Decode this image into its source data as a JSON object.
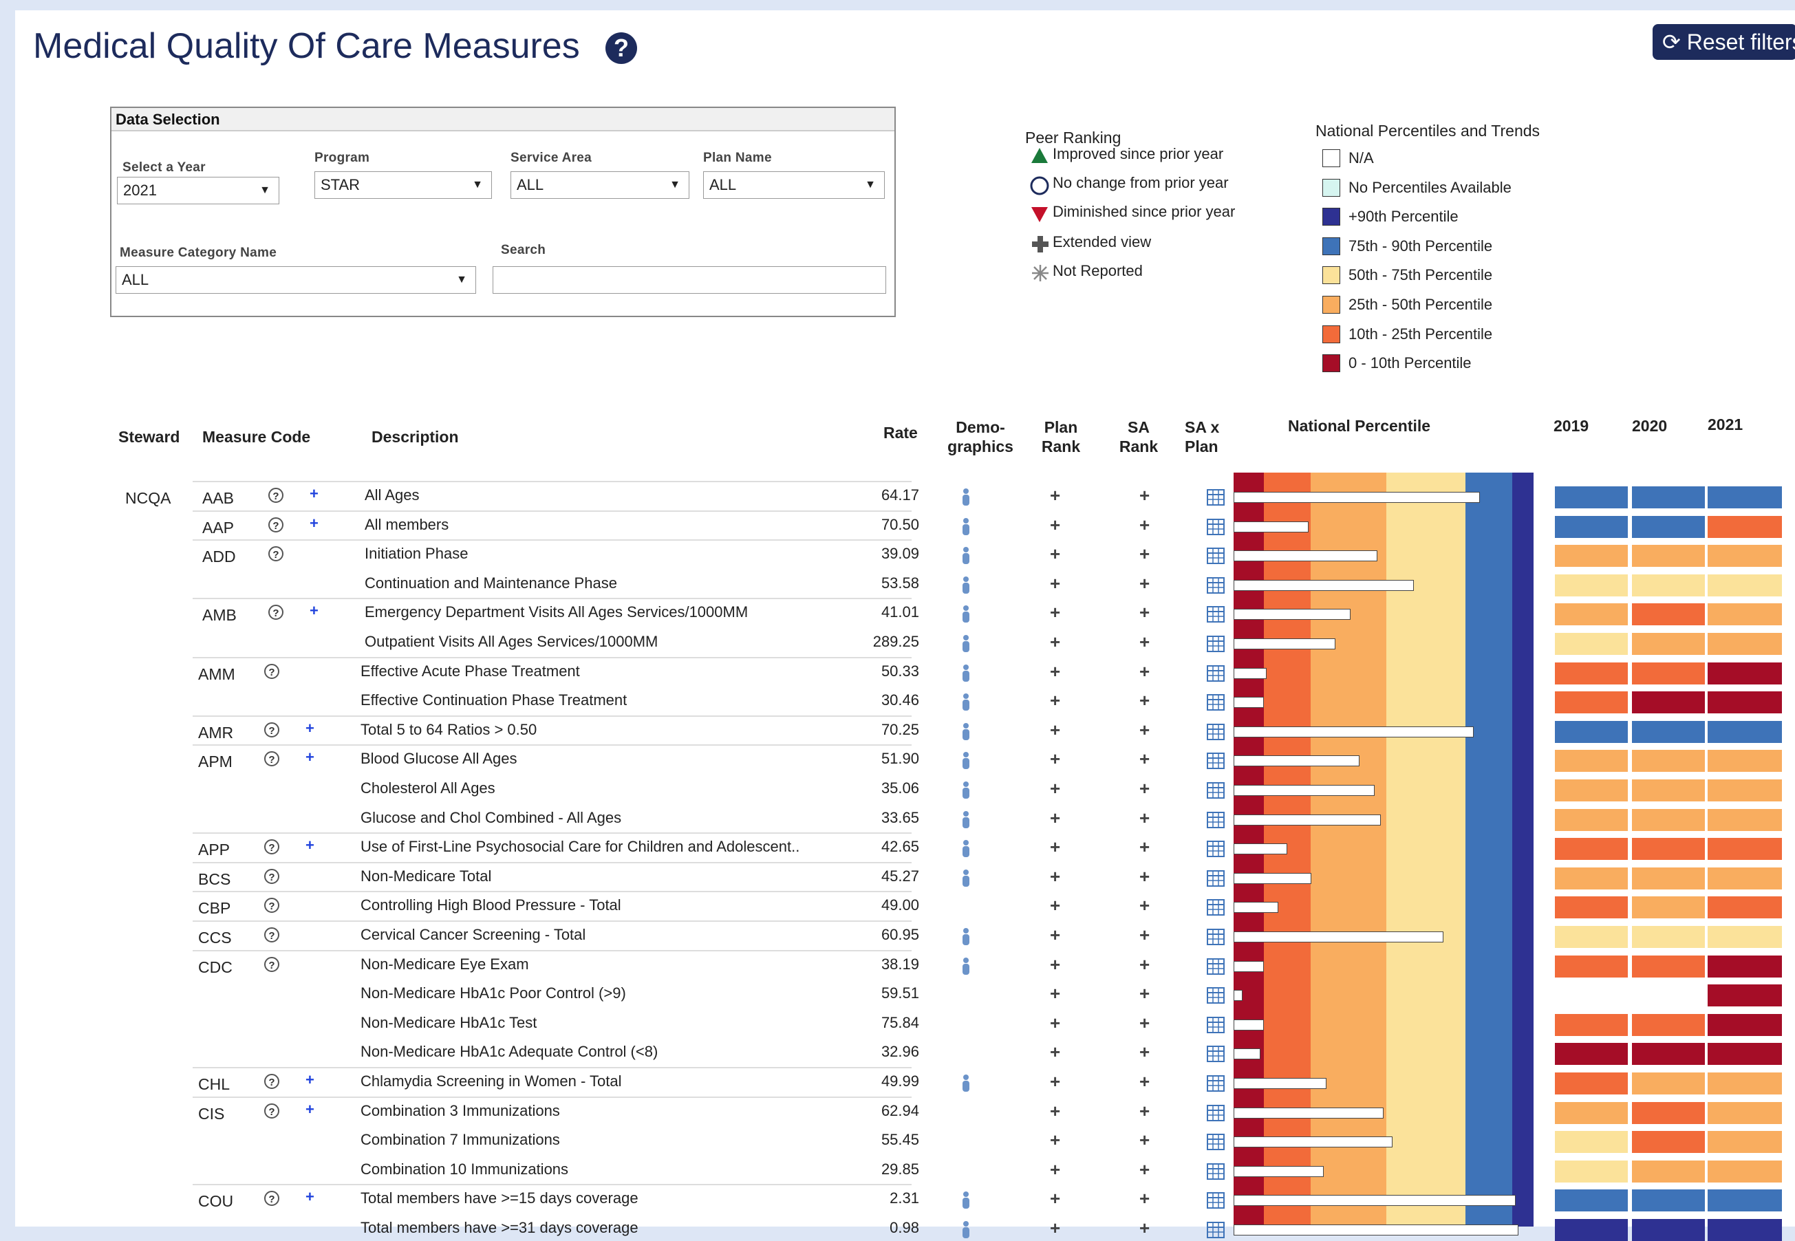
{
  "header": {
    "title": "Medical Quality Of Care Measures",
    "help_glyph": "?",
    "reset_label": "Reset filters",
    "reset_glyph": "⟳"
  },
  "data_selection": {
    "title": "Data Selection",
    "year_label": "Select a Year",
    "year_value": "2021",
    "program_label": "Program",
    "program_value": "STAR",
    "service_area_label": "Service Area",
    "service_area_value": "ALL",
    "plan_name_label": "Plan Name",
    "plan_name_value": "ALL",
    "measure_category_label": "Measure Category Name",
    "measure_category_value": "ALL",
    "search_label": "Search",
    "search_value": ""
  },
  "peer_ranking": {
    "title": "Peer Ranking",
    "items": [
      {
        "label": "Improved since prior year",
        "icon": "triangle-up-green"
      },
      {
        "label": "No change from prior year",
        "icon": "circle-blue"
      },
      {
        "label": "Diminished since prior year",
        "icon": "triangle-down-red"
      },
      {
        "label": "Extended view",
        "icon": "plus-gray"
      },
      {
        "label": "Not Reported",
        "icon": "asterisk-gray"
      }
    ]
  },
  "national_percentiles": {
    "title": "National Percentiles and Trends",
    "items": [
      {
        "label": "N/A",
        "color": "#ffffff"
      },
      {
        "label": "No Percentiles Available",
        "color": "#d6f5f0"
      },
      {
        "label": "+90th Percentile",
        "color": "#2e3192"
      },
      {
        "label": "75th - 90th Percentile",
        "color": "#3e73b8"
      },
      {
        "label": "50th - 75th Percentile",
        "color": "#fbe29a"
      },
      {
        "label": "25th - 50th Percentile",
        "color": "#f9ad5f"
      },
      {
        "label": "10th - 25th Percentile",
        "color": "#f26b3a"
      },
      {
        "label": "0 - 10th Percentile",
        "color": "#a50d27"
      }
    ]
  },
  "table": {
    "headers": {
      "steward": "Steward",
      "measure_code": "Measure Code",
      "description": "Description",
      "rate": "Rate",
      "demographics_1": "Demo-",
      "demographics_2": "graphics",
      "plan_rank_1": "Plan",
      "plan_rank_2": "Rank",
      "sa_rank_1": "SA",
      "sa_rank_2": "Rank",
      "sa_plan_1": "SA x",
      "sa_plan_2": "Plan",
      "national_percentile": "National Percentile",
      "y2019": "2019",
      "y2020": "2020",
      "y2021": "2021"
    },
    "steward_value": "NCQA",
    "rows": [
      {
        "code": "AAB",
        "plus": true,
        "desc": "All Ages",
        "rate": "64.17",
        "demo": true,
        "pct": 0.82,
        "trend": [
          "#3e73b8",
          "#3e73b8",
          "#3e73b8"
        ]
      },
      {
        "code": "AAP",
        "plus": true,
        "desc": "All members",
        "rate": "70.50",
        "demo": true,
        "pct": 0.25,
        "trend": [
          "#3e73b8",
          "#3e73b8",
          "#f26b3a"
        ]
      },
      {
        "code": "ADD",
        "plus": false,
        "desc": "Initiation Phase",
        "rate": "39.09",
        "demo": true,
        "pct": 0.48,
        "trend": [
          "#f9ad5f",
          "#f9ad5f",
          "#f9ad5f"
        ]
      },
      {
        "code": "",
        "plus": false,
        "desc": "Continuation and Maintenance Phase",
        "rate": "53.58",
        "demo": true,
        "pct": 0.6,
        "trend": [
          "#fbe29a",
          "#fbe29a",
          "#fbe29a"
        ]
      },
      {
        "code": "AMB",
        "plus": true,
        "desc": "Emergency Department  Visits All Ages Services/1000MM",
        "rate": "41.01",
        "demo": true,
        "pct": 0.39,
        "trend": [
          "#f9ad5f",
          "#f26b3a",
          "#f9ad5f"
        ]
      },
      {
        "code": "",
        "plus": false,
        "desc": "Outpatient Visits All Ages Services/1000MM",
        "rate": "289.25",
        "demo": true,
        "pct": 0.34,
        "trend": [
          "#fbe29a",
          "#f9ad5f",
          "#f9ad5f"
        ]
      },
      {
        "code": "AMM",
        "plus": false,
        "desc": "Effective Acute Phase Treatment",
        "rate": "50.33",
        "demo": true,
        "pct": 0.11,
        "trend": [
          "#f26b3a",
          "#f26b3a",
          "#a50d27"
        ]
      },
      {
        "code": "",
        "plus": false,
        "desc": "Effective Continuation Phase Treatment",
        "rate": "30.46",
        "demo": true,
        "pct": 0.1,
        "trend": [
          "#f26b3a",
          "#a50d27",
          "#a50d27"
        ]
      },
      {
        "code": "AMR",
        "plus": true,
        "desc": "Total 5 to 64 Ratios > 0.50",
        "rate": "70.25",
        "demo": true,
        "pct": 0.8,
        "trend": [
          "#3e73b8",
          "#3e73b8",
          "#3e73b8"
        ]
      },
      {
        "code": "APM",
        "plus": true,
        "desc": "Blood Glucose All Ages",
        "rate": "51.90",
        "demo": true,
        "pct": 0.42,
        "trend": [
          "#f9ad5f",
          "#f9ad5f",
          "#f9ad5f"
        ]
      },
      {
        "code": "",
        "plus": false,
        "desc": "Cholesterol All Ages",
        "rate": "35.06",
        "demo": true,
        "pct": 0.47,
        "trend": [
          "#f9ad5f",
          "#f9ad5f",
          "#f9ad5f"
        ]
      },
      {
        "code": "",
        "plus": false,
        "desc": "Glucose and Chol Combined - All Ages",
        "rate": "33.65",
        "demo": true,
        "pct": 0.49,
        "trend": [
          "#f9ad5f",
          "#f9ad5f",
          "#f9ad5f"
        ]
      },
      {
        "code": "APP",
        "plus": true,
        "desc": "Use of First-Line Psychosocial Care for Children and Adolescent..",
        "rate": "42.65",
        "demo": true,
        "pct": 0.18,
        "trend": [
          "#f26b3a",
          "#f26b3a",
          "#f26b3a"
        ]
      },
      {
        "code": "BCS",
        "plus": false,
        "desc": "Non-Medicare Total",
        "rate": "45.27",
        "demo": true,
        "pct": 0.26,
        "trend": [
          "#f9ad5f",
          "#f9ad5f",
          "#f9ad5f"
        ]
      },
      {
        "code": "CBP",
        "plus": false,
        "desc": "Controlling High Blood Pressure - Total",
        "rate": "49.00",
        "demo": false,
        "pct": 0.15,
        "trend": [
          "#f26b3a",
          "#f9ad5f",
          "#f26b3a"
        ]
      },
      {
        "code": "CCS",
        "plus": false,
        "desc": "Cervical Cancer Screening - Total",
        "rate": "60.95",
        "demo": true,
        "pct": 0.7,
        "trend": [
          "#fbe29a",
          "#fbe29a",
          "#fbe29a"
        ]
      },
      {
        "code": "CDC",
        "plus": false,
        "desc": "Non-Medicare Eye Exam",
        "rate": "38.19",
        "demo": true,
        "pct": 0.1,
        "trend": [
          "#f26b3a",
          "#f26b3a",
          "#a50d27"
        ]
      },
      {
        "code": "",
        "plus": false,
        "desc": "Non-Medicare HbA1c Poor Control (>9)",
        "rate": "59.51",
        "demo": false,
        "pct": 0.03,
        "trend": [
          "#ffffff",
          "#ffffff",
          "#a50d27"
        ]
      },
      {
        "code": "",
        "plus": false,
        "desc": "Non-Medicare HbA1c Test",
        "rate": "75.84",
        "demo": false,
        "pct": 0.1,
        "trend": [
          "#f26b3a",
          "#f26b3a",
          "#a50d27"
        ]
      },
      {
        "code": "",
        "plus": false,
        "desc": "Non-Medicare HbA1c Adequate Control (<8)",
        "rate": "32.96",
        "demo": false,
        "pct": 0.09,
        "trend": [
          "#a50d27",
          "#a50d27",
          "#a50d27"
        ]
      },
      {
        "code": "CHL",
        "plus": true,
        "desc": "Chlamydia Screening in Women - Total",
        "rate": "49.99",
        "demo": true,
        "pct": 0.31,
        "trend": [
          "#f26b3a",
          "#f9ad5f",
          "#f9ad5f"
        ]
      },
      {
        "code": "CIS",
        "plus": true,
        "desc": "Combination 3 Immunizations",
        "rate": "62.94",
        "demo": false,
        "pct": 0.5,
        "trend": [
          "#f9ad5f",
          "#f26b3a",
          "#f9ad5f"
        ]
      },
      {
        "code": "",
        "plus": false,
        "desc": "Combination 7 Immunizations",
        "rate": "55.45",
        "demo": false,
        "pct": 0.53,
        "trend": [
          "#fbe29a",
          "#f26b3a",
          "#f9ad5f"
        ]
      },
      {
        "code": "",
        "plus": false,
        "desc": "Combination 10 Immunizations",
        "rate": "29.85",
        "demo": false,
        "pct": 0.3,
        "trend": [
          "#fbe29a",
          "#f9ad5f",
          "#f9ad5f"
        ]
      },
      {
        "code": "COU",
        "plus": true,
        "desc": "Total members have >=15 days coverage",
        "rate": "2.31",
        "demo": true,
        "pct": 0.94,
        "trend": [
          "#3e73b8",
          "#3e73b8",
          "#3e73b8"
        ]
      },
      {
        "code": "",
        "plus": false,
        "desc": "Total members have >=31 days coverage",
        "rate": "0.98",
        "demo": true,
        "pct": 0.95,
        "trend": [
          "#2e3192",
          "#2e3192",
          "#2e3192"
        ]
      }
    ]
  }
}
